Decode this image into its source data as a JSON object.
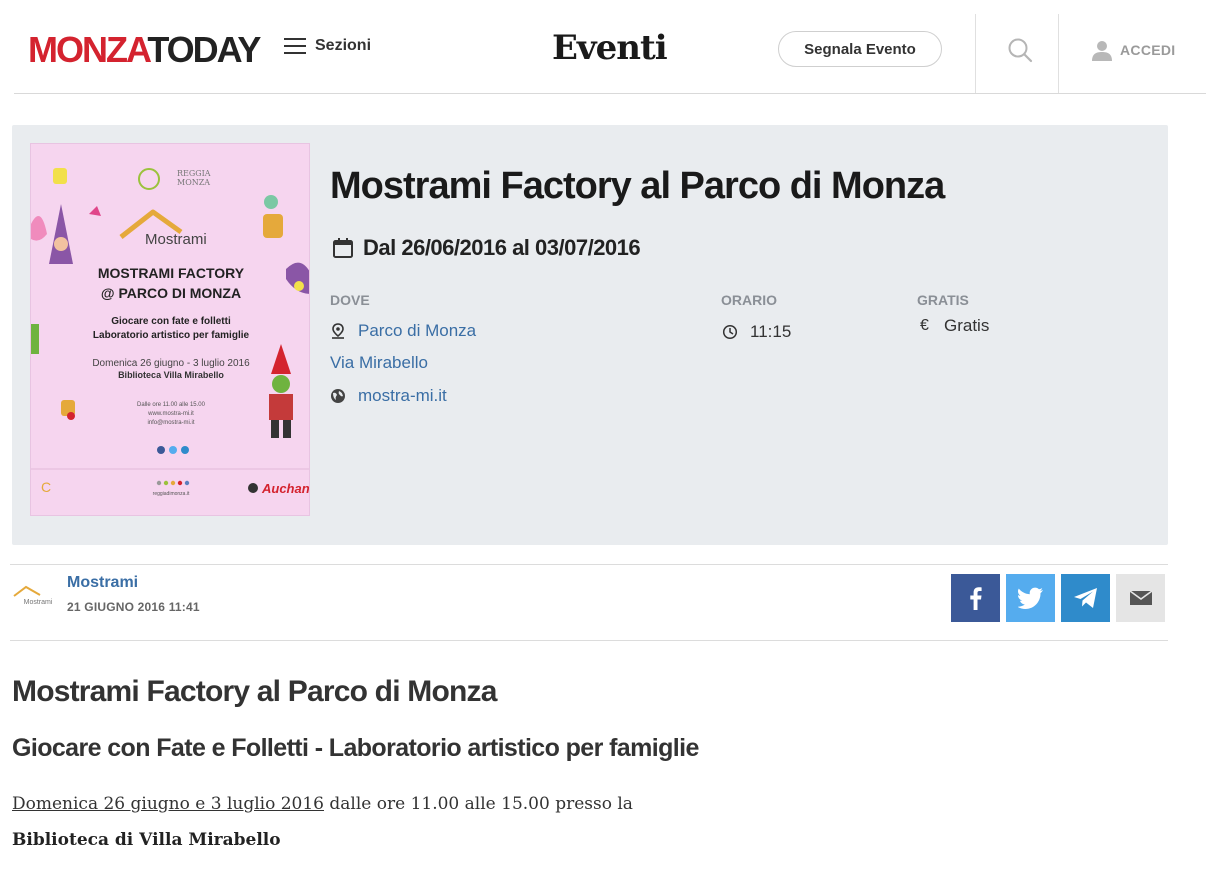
{
  "header": {
    "logo_part1": "MONZA",
    "logo_part2": "TODAY",
    "menu_label": "Sezioni",
    "section_title": "Eventi",
    "report_button": "Segnala Evento",
    "login_label": "ACCEDI",
    "brand_color": "#d4232f"
  },
  "event": {
    "title": "Mostrami Factory al Parco di Monza",
    "dates": "Dal 26/06/2016 al 03/07/2016",
    "where_label": "DOVE",
    "place": "Parco di Monza",
    "address": "Via Mirabello",
    "website": "mostra-mi.it",
    "time_label": "ORARIO",
    "time": "11:15",
    "price_label": "GRATIS",
    "price": "Gratis",
    "poster": {
      "brand": "REGGIA\nMONZA",
      "logo_text": "Mostrami",
      "headline1": "MOSTRAMI FACTORY",
      "headline2": "@ PARCO DI MONZA",
      "line1": "Giocare con fate e folletti",
      "line2": "Laboratorio artistico per famiglie",
      "line3": "Domenica 26 giugno - 3 luglio 2016",
      "line4": "Biblioteca Villa Mirabello",
      "line5": "Dalle ore 11.00 alle 15.00",
      "line6": "www.mostra-mi.it",
      "line7": "info@mostra-mi.it",
      "footer_site": "reggiadimonza.it",
      "sponsor": "Auchan"
    }
  },
  "author": {
    "name": "Mostrami",
    "date": "21 GIUGNO 2016 11:41",
    "avatar_text": "Mostrami"
  },
  "share": {
    "facebook_color": "#3b5998",
    "twitter_color": "#55acee",
    "telegram_color": "#2f8bcb",
    "email_color": "#e5e5e5"
  },
  "article": {
    "title": "Mostrami Factory al Parco di Monza",
    "subtitle": "Giocare con Fate e Folletti - Laboratorio artistico per famiglie",
    "p1_link": "Domenica 26 giugno e 3 luglio 2016",
    "p1_rest": " dalle ore 11.00 alle 15.00 presso la",
    "p2": "Biblioteca di Villa Mirabello"
  }
}
